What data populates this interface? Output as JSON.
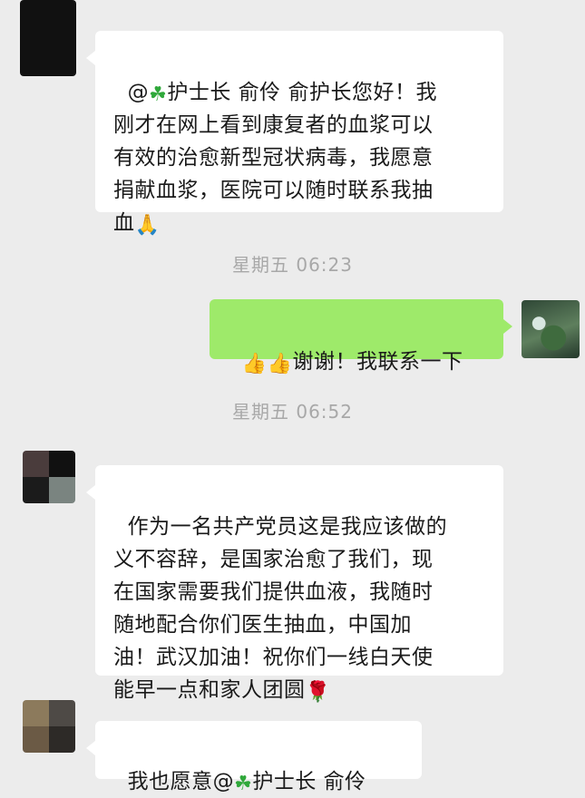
{
  "messages": {
    "m1": {
      "prefix": "@",
      "mention_icon": "four-leaf-clover-emoji",
      "body": "护士长 俞伶 俞护长您好！我\n刚才在网上看到康复者的血浆可以\n有效的治愈新型冠状病毒，我愿意\n捐献血浆，医院可以随时联系我抽\n血",
      "end_icon": "folded-hands-emoji"
    },
    "ts1": "星期五 06:23",
    "m2": {
      "lead_icons": [
        "thumbs-up-emoji",
        "thumbs-up-emoji"
      ],
      "body": "谢谢！我联系一下"
    },
    "ts2": "星期五 06:52",
    "m3": {
      "body": "作为一名共产党员这是我应该做的\n义不容辞，是国家治愈了我们，现\n在国家需要我们提供血液，我随时\n随地配合你们医生抽血，中国加\n油！武汉加油！祝你们一线白天使\n能早一点和家人团圆",
      "end_icon": "rose-emoji"
    },
    "m4": {
      "body_before": "我也愿意@",
      "mention_icon": "four-leaf-clover-emoji",
      "body_after": "护士长 俞伶"
    }
  },
  "colors": {
    "chat_bg": "#ececec",
    "incoming_bubble": "#ffffff",
    "outgoing_bubble": "#9eea6a",
    "timestamp_text": "#a8a8a8"
  }
}
